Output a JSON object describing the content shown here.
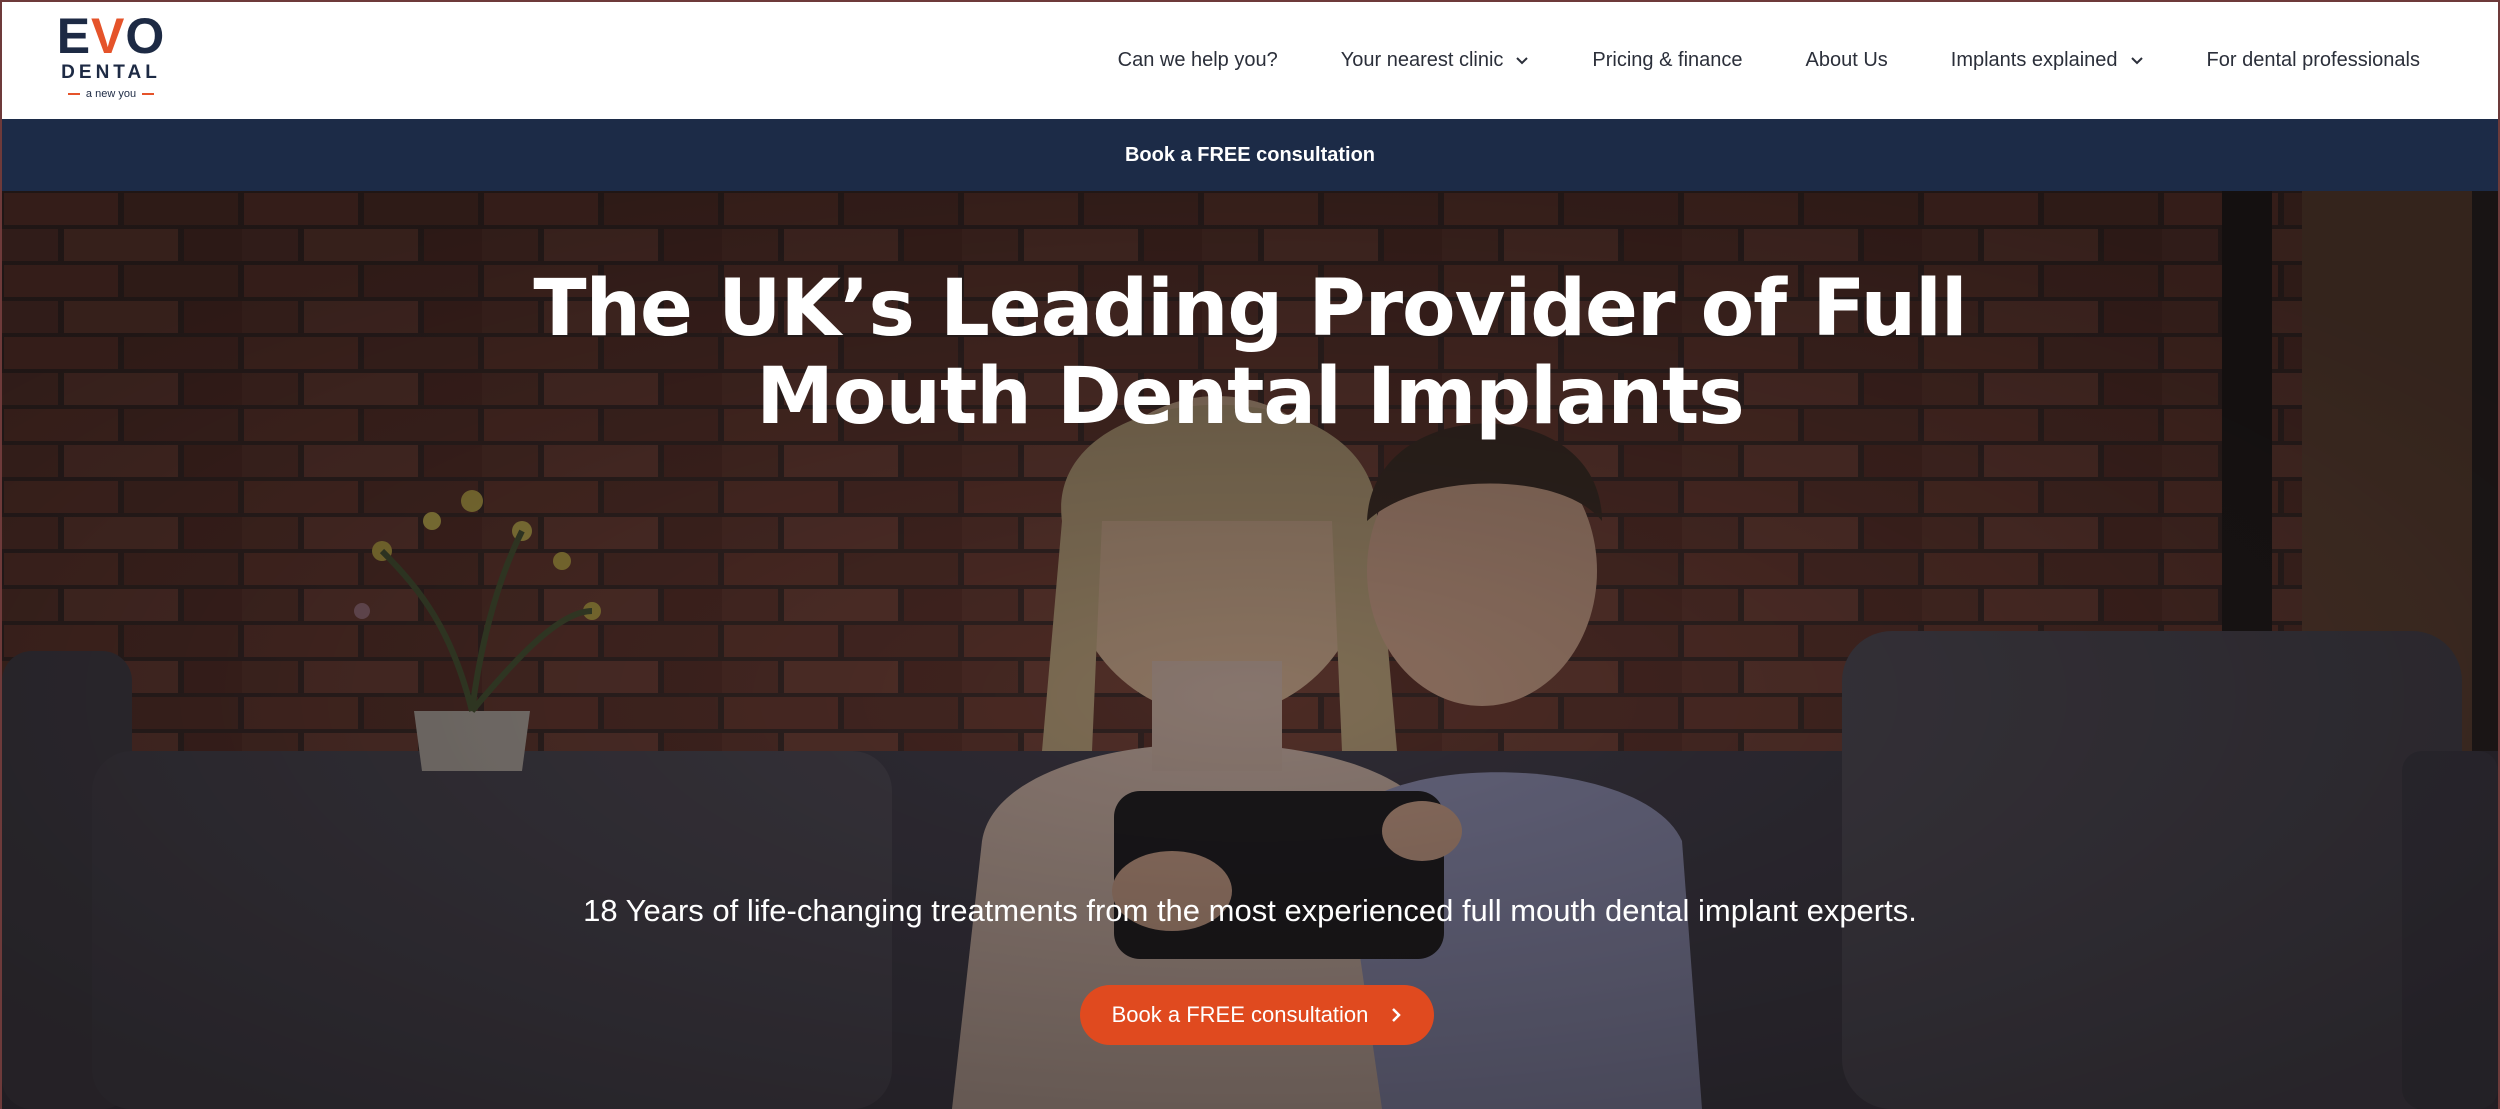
{
  "brand": {
    "logo_top_left": "E",
    "logo_top_v": "V",
    "logo_top_right": "O",
    "logo_mid": "DENTAL",
    "logo_tag": "a new you",
    "accent": "#e5532a",
    "navy": "#1d2a44"
  },
  "nav": {
    "items": [
      {
        "label": "Can we help you?",
        "has_dropdown": false
      },
      {
        "label": "Your nearest clinic",
        "has_dropdown": true
      },
      {
        "label": "Pricing & finance",
        "has_dropdown": false
      },
      {
        "label": "About Us",
        "has_dropdown": false
      },
      {
        "label": "Implants explained",
        "has_dropdown": true
      },
      {
        "label": "For dental professionals",
        "has_dropdown": false
      }
    ]
  },
  "banner": {
    "label": "Book a FREE consultation",
    "background": "#1c2b47"
  },
  "hero": {
    "title_line1": "The UK’s Leading Provider of Full",
    "title_line2": "Mouth Dental Implants",
    "subtitle": "18 Years of life-changing treatments from the most experienced full mouth dental implant experts.",
    "cta_label": "Book a FREE consultation",
    "cta_color": "#e04a1f"
  }
}
